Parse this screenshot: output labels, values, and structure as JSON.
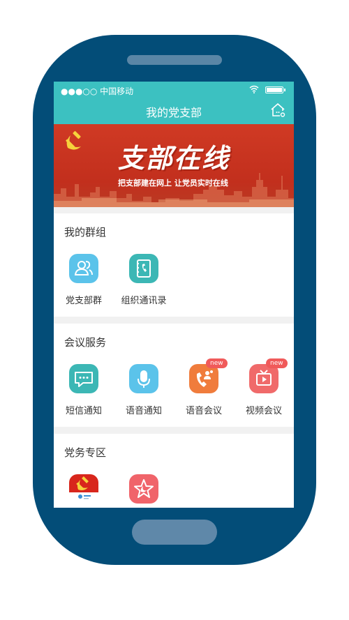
{
  "status_bar": {
    "carrier": "●●●○○ 中国移动"
  },
  "nav": {
    "title": "我的党支部"
  },
  "banner": {
    "title": "支部在线",
    "subtitle": "把支部建在网上  让党员实时在线"
  },
  "sections": [
    {
      "title": "我的群组",
      "items": [
        {
          "label": "党支部群",
          "icon": "people-icon",
          "color": "#5bc3ea"
        },
        {
          "label": "组织通讯录",
          "icon": "phonebook-icon",
          "color": "#3cb7b5"
        }
      ]
    },
    {
      "title": "会议服务",
      "items": [
        {
          "label": "短信通知",
          "icon": "sms-icon",
          "color": "#3cb7b5"
        },
        {
          "label": "语音通知",
          "icon": "microphone-icon",
          "color": "#5bc3ea"
        },
        {
          "label": "语音会议",
          "icon": "voice-conference-icon",
          "color": "#f07c3c",
          "badge": "new"
        },
        {
          "label": "视频会议",
          "icon": "video-conference-icon",
          "color": "#f06a6a",
          "badge": "new"
        }
      ]
    },
    {
      "title": "党务专区",
      "items": [
        {
          "label": "",
          "icon": "party-emblem-app-icon",
          "color": "#d8261c"
        },
        {
          "label": "",
          "icon": "party-star-icon",
          "color": "#f0646a"
        }
      ]
    }
  ]
}
